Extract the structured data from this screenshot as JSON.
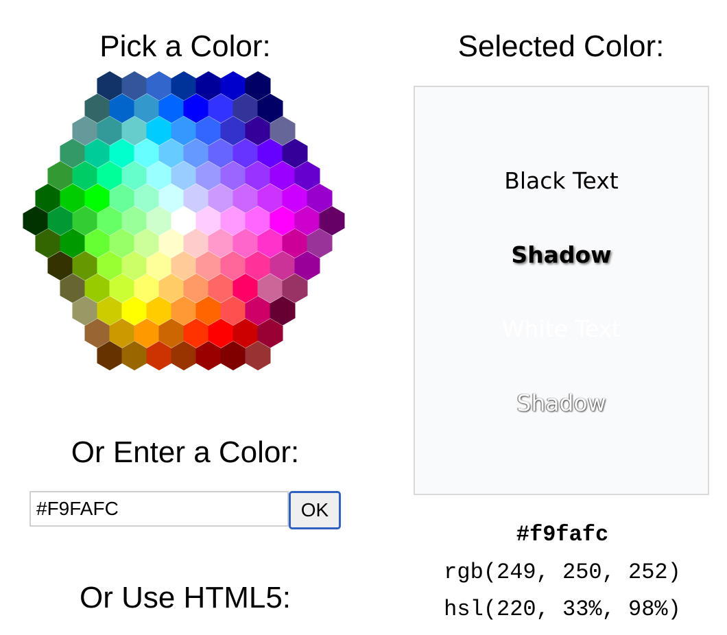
{
  "headings": {
    "pick": "Pick a Color:",
    "selected": "Selected Color:",
    "enter": "Or Enter a Color:",
    "html5": "Or Use HTML5:"
  },
  "input": {
    "value": "#F9FAFC",
    "ok_label": "OK"
  },
  "preview": {
    "background": "#f9fafc",
    "black_text": "Black Text",
    "black_shadow": "Shadow",
    "white_text": "White Text",
    "white_shadow": "Shadow"
  },
  "values": {
    "hex": "#f9fafc",
    "rgb": "rgb(249, 250, 252)",
    "hsl": "hsl(220, 33%, 98%)"
  },
  "color_map": {
    "rows": [
      [
        "#113366",
        "#335599",
        "#3366cc",
        "#003399",
        "#000099",
        "#0000cc",
        "#000066"
      ],
      [
        "#336666",
        "#0066cc",
        "#3399cc",
        "#0066ff",
        "#0000ff",
        "#3333ff",
        "#333399",
        "#000066"
      ],
      [
        "#669999",
        "#339999",
        "#66cccc",
        "#00ccff",
        "#3399ff",
        "#3366ff",
        "#3333cc",
        "#330099",
        "#666699"
      ],
      [
        "#339966",
        "#00cc99",
        "#00ffcc",
        "#66ffff",
        "#66ccff",
        "#6699ff",
        "#6666ff",
        "#6633ff",
        "#6600ff",
        "#330099"
      ],
      [
        "#339933",
        "#00cc66",
        "#00ff99",
        "#66ffcc",
        "#99ffff",
        "#99ccff",
        "#9999ff",
        "#9966ff",
        "#9933ff",
        "#9900ff",
        "#6600cc"
      ],
      [
        "#006600",
        "#00cc00",
        "#00ff00",
        "#66ff99",
        "#99ffcc",
        "#ccffff",
        "#ccccff",
        "#cc99ff",
        "#cc66ff",
        "#cc33ff",
        "#cc00ff",
        "#9900cc"
      ],
      [
        "#003300",
        "#009933",
        "#33cc33",
        "#66ff66",
        "#99ff99",
        "#ccffcc",
        "#ffffff",
        "#ffccff",
        "#ff99ff",
        "#ff66ff",
        "#ff00ff",
        "#cc00cc",
        "#660066"
      ],
      [
        "#336600",
        "#009900",
        "#66ff33",
        "#99ff66",
        "#ccff99",
        "#ffffcc",
        "#ffcccc",
        "#ff99cc",
        "#ff66cc",
        "#ff33cc",
        "#cc0099",
        "#993399"
      ],
      [
        "#333300",
        "#669900",
        "#99ff33",
        "#ccff66",
        "#ffff99",
        "#ffcc99",
        "#ff9999",
        "#ff6699",
        "#ff3399",
        "#cc3399",
        "#990099"
      ],
      [
        "#666633",
        "#99cc00",
        "#ccff33",
        "#ffff66",
        "#ffcc66",
        "#ff9966",
        "#ff6666",
        "#ff0066",
        "#cc6699",
        "#993366"
      ],
      [
        "#999966",
        "#cccc00",
        "#ffff00",
        "#ffcc00",
        "#ff9933",
        "#ff6600",
        "#ff5050",
        "#cc0066",
        "#660033"
      ],
      [
        "#996633",
        "#cc9900",
        "#ff9900",
        "#cc6600",
        "#ff3300",
        "#ff0000",
        "#cc0000",
        "#990033"
      ],
      [
        "#663300",
        "#996600",
        "#cc3300",
        "#993300",
        "#990000",
        "#800000",
        "#993333"
      ]
    ]
  }
}
